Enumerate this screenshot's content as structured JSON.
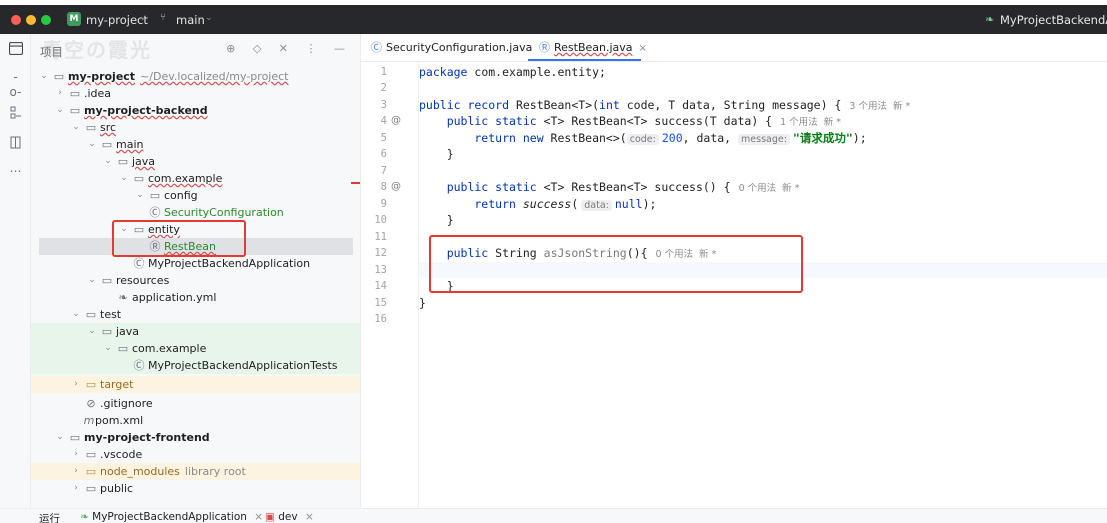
{
  "titlebar": {
    "project_badge": "M",
    "project_name": "my-project",
    "branch_icon": "⑂",
    "branch_name": "main",
    "run_config": "MyProjectBackendApp"
  },
  "tools": {
    "project": "project-icon",
    "commit": "commit-icon",
    "structure": "structure-icon",
    "bookmarks": "bookmark-icon",
    "more": "more-icon"
  },
  "panel": {
    "title": "项目",
    "watermark": "青空の霞光",
    "actions": "⊕ ◇ ✕ ⋮ —"
  },
  "tree": [
    {
      "label": "my-project",
      "sub": "~/Dev.localized/my-project",
      "chev": "⌄",
      "icon": "▭"
    },
    {
      "label": ".idea",
      "chev": "›",
      "icon": "▭"
    },
    {
      "label": "my-project-backend",
      "chev": "⌄",
      "icon": "▭"
    },
    {
      "label": "src",
      "chev": "⌄",
      "icon": "▭"
    },
    {
      "label": "main",
      "chev": "⌄",
      "icon": "▭"
    },
    {
      "label": "java",
      "chev": "⌄",
      "icon": "▭"
    },
    {
      "label": "com.example",
      "chev": "⌄",
      "icon": "▭"
    },
    {
      "label": "config",
      "chev": "⌄",
      "icon": "▭"
    },
    {
      "label": "SecurityConfiguration",
      "icon": "Ⓒ"
    },
    {
      "label": "entity",
      "chev": "⌄",
      "icon": "▭"
    },
    {
      "label": "RestBean",
      "icon": "Ⓡ"
    },
    {
      "label": "MyProjectBackendApplication",
      "icon": "Ⓒ"
    },
    {
      "label": "resources",
      "chev": "⌄",
      "icon": "▭"
    },
    {
      "label": "application.yml",
      "icon": "❧"
    },
    {
      "label": "test",
      "chev": "⌄",
      "icon": "▭"
    },
    {
      "label": "java",
      "chev": "⌄",
      "icon": "▭"
    },
    {
      "label": "com.example",
      "chev": "⌄",
      "icon": "▭"
    },
    {
      "label": "MyProjectBackendApplicationTests",
      "icon": "Ⓒ"
    },
    {
      "label": "target",
      "chev": "›",
      "icon": "▭"
    },
    {
      "label": ".gitignore",
      "icon": "⊘"
    },
    {
      "label": "pom.xml",
      "icon": "m"
    },
    {
      "label": "my-project-frontend",
      "chev": "⌄",
      "icon": "▭"
    },
    {
      "label": ".vscode",
      "chev": "›",
      "icon": "▭"
    },
    {
      "label": "node_modules",
      "sub": "library root",
      "chev": "›",
      "icon": "▭"
    },
    {
      "label": "public",
      "chev": "›",
      "icon": "▭"
    }
  ],
  "tabs": [
    {
      "label": "SecurityConfiguration.java",
      "icon": "Ⓒ"
    },
    {
      "label": "RestBean.java",
      "icon": "Ⓡ",
      "close": "×"
    }
  ],
  "gutter": {
    "lines": [
      "1",
      "2",
      "3",
      "4",
      "5",
      "6",
      "7",
      "8",
      "9",
      "10",
      "11",
      "12",
      "13",
      "14",
      "15",
      "16"
    ],
    "marker_4": "@",
    "marker_8": "@"
  },
  "code": {
    "l1_kw": "package",
    "l1_rest": " com.example.entity;",
    "l3_kw": "public record",
    "l3_rest": " RestBean<T>(",
    "l3_int": "int",
    "l3_rest2": " code, T data, String message) {",
    "l3_usage": "3 个用法  新 *",
    "l4_kw": "    public static",
    "l4_rest": " <T> RestBean<T> success(T data) {",
    "l4_usage": "1 个用法  新 *",
    "l5_kw": "        return new",
    "l5_rest": " RestBean<>(",
    "l5_hint_code": "code:",
    "l5_num": "200",
    "l5_mid": ", data, ",
    "l5_hint_msg": "message:",
    "l5_str": "\"请求成功\"",
    "l5_end": ");",
    "l6": "    }",
    "l8_kw": "    public static",
    "l8_rest": " <T> RestBean<T> success() {",
    "l8_usage": "0 个用法  新 *",
    "l9_kw": "        return",
    "l9_call": " success",
    "l9_paren": "(",
    "l9_hint": "data:",
    "l9_null": "null",
    "l9_end": ");",
    "l10": "    }",
    "l12_kw": "    public",
    "l12_type": " String ",
    "l12_fn": "asJsonString",
    "l12_end": "(){",
    "l12_usage": "0 个用法  新 *",
    "l14": "    }",
    "l15": "}"
  },
  "bottom": {
    "run_label": "运行",
    "tab1_icon": "❧",
    "tab1": "MyProjectBackendApplication",
    "tab1_close": "×",
    "tab2_icon": "▣",
    "tab2": "dev",
    "tab2_close": "×"
  }
}
